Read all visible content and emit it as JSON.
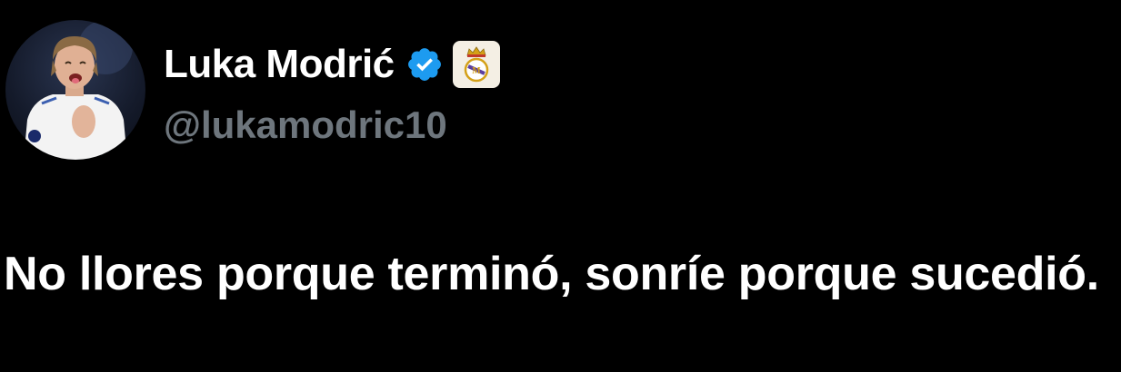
{
  "tweet": {
    "author": {
      "display_name": "Luka Modrić",
      "handle": "@lukamodric10",
      "verified_icon": "verified-badge-icon",
      "affiliate_icon": "real-madrid-crest-icon",
      "avatar_icon": "profile-photo"
    },
    "text": "No llores porque terminó, sonríe porque sucedió."
  },
  "colors": {
    "background": "#000000",
    "text_primary": "#ffffff",
    "text_secondary": "#6e767d",
    "verified_blue": "#1d9bf0"
  }
}
